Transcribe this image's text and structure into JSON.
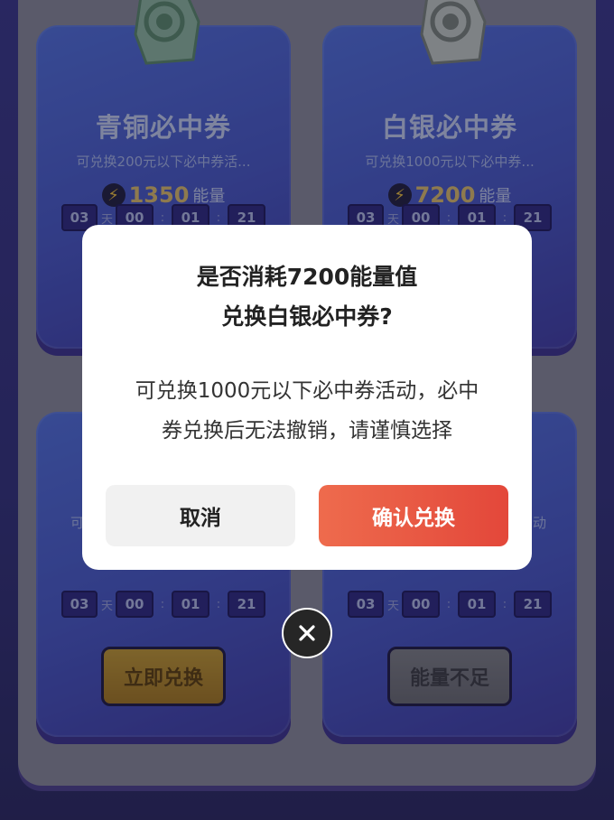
{
  "cards": [
    {
      "title": "青铜必中券",
      "desc": "可兑换200元以下必中券活...",
      "cost": "1350",
      "unit": "能量",
      "timer": {
        "days": "03",
        "day_label": "天",
        "h": "00",
        "m": "01",
        "s": "21",
        "sep": ":"
      }
    },
    {
      "title": "白银必中券",
      "desc": "可兑换1000元以下必中券...",
      "cost": "7200",
      "unit": "能量",
      "timer": {
        "days": "03",
        "day_label": "天",
        "h": "00",
        "m": "01",
        "s": "21",
        "sep": ":"
      }
    },
    {
      "desc_partial": "可",
      "timer": {
        "days": "03",
        "day_label": "天",
        "h": "00",
        "m": "01",
        "s": "21",
        "sep": ":"
      },
      "button": "立即兑换"
    },
    {
      "desc_partial": "动",
      "timer": {
        "days": "03",
        "day_label": "天",
        "h": "00",
        "m": "01",
        "s": "21",
        "sep": ":"
      },
      "button": "能量不足"
    }
  ],
  "dialog": {
    "title_line1": "是否消耗7200能量值",
    "title_line2": "兑换白银必中券?",
    "body_line1": "可兑换1000元以下必中券活动，必中",
    "body_line2": "券兑换后无法撤销，请谨慎选择",
    "cancel_label": "取消",
    "confirm_label": "确认兑换"
  },
  "icons": {
    "bolt": "lightning-icon",
    "close": "close-icon",
    "ticket": "ticket-icon"
  },
  "colors": {
    "confirm_start": "#ee6b4d",
    "confirm_end": "#e3473a",
    "card_blue": "#4f6fe0",
    "energy_gold": "#e3c26a"
  }
}
